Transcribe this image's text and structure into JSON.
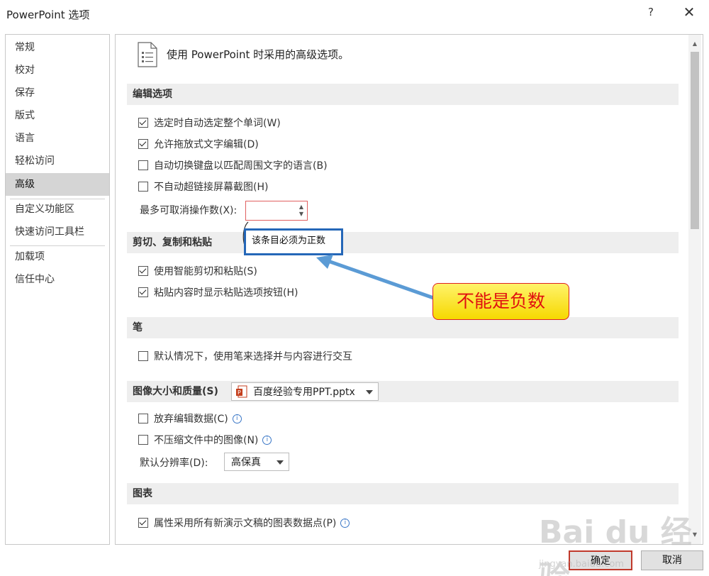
{
  "window": {
    "title": "PowerPoint 选项",
    "help": "?",
    "close": "✕"
  },
  "nav": {
    "items": [
      {
        "label": "常规"
      },
      {
        "label": "校对"
      },
      {
        "label": "保存"
      },
      {
        "label": "版式"
      },
      {
        "label": "语言"
      },
      {
        "label": "轻松访问"
      },
      {
        "label": "高级",
        "active": true
      },
      {
        "label": "自定义功能区"
      },
      {
        "label": "快速访问工具栏"
      },
      {
        "label": "加载项"
      },
      {
        "label": "信任中心"
      }
    ]
  },
  "header": {
    "text": "使用 PowerPoint 时采用的高级选项。"
  },
  "sections": {
    "editing": {
      "title": "编辑选项",
      "options": [
        {
          "label": "选定时自动选定整个单词(W)",
          "checked": true
        },
        {
          "label": "允许拖放式文字编辑(D)",
          "checked": true
        },
        {
          "label": "自动切换键盘以匹配周围文字的语言(B)",
          "checked": false
        },
        {
          "label": "不自动超链接屏幕截图(H)",
          "checked": false
        }
      ],
      "undo_label": "最多可取消操作数(X):",
      "undo_value": "",
      "tooltip": "该条目必须为正数"
    },
    "clipboard": {
      "title": "剪切、复制和粘贴",
      "options": [
        {
          "label": "使用智能剪切和粘贴(S)",
          "checked": true
        },
        {
          "label": "粘贴内容时显示粘贴选项按钮(H)",
          "checked": true
        }
      ]
    },
    "pen": {
      "title": "笔",
      "options": [
        {
          "label": "默认情况下，使用笔来选择并与内容进行交互",
          "checked": false
        }
      ]
    },
    "image": {
      "title": "图像大小和质量(S)",
      "file": "百度经验专用PPT.pptx",
      "options": [
        {
          "label": "放弃编辑数据(C)",
          "checked": false,
          "info": "i"
        },
        {
          "label": "不压缩文件中的图像(N)",
          "checked": false,
          "info": "i"
        }
      ],
      "resolution_label": "默认分辨率(D):",
      "resolution_value": "高保真"
    },
    "chart": {
      "title": "图表",
      "options": [
        {
          "label": "属性采用所有新演示文稿的图表数据点(P)",
          "checked": true,
          "info": "i"
        }
      ]
    }
  },
  "callout": {
    "text": "不能是负数"
  },
  "buttons": {
    "ok": "确定",
    "cancel": "取消"
  },
  "watermark": {
    "text": "Bai du 经验",
    "sub": "jingyan.baidu.com"
  },
  "colors": {
    "tooltip_border": "#2567b8",
    "callout_fill": "#f6d800",
    "callout_text": "#e01010",
    "arrow": "#5b9bd5"
  }
}
